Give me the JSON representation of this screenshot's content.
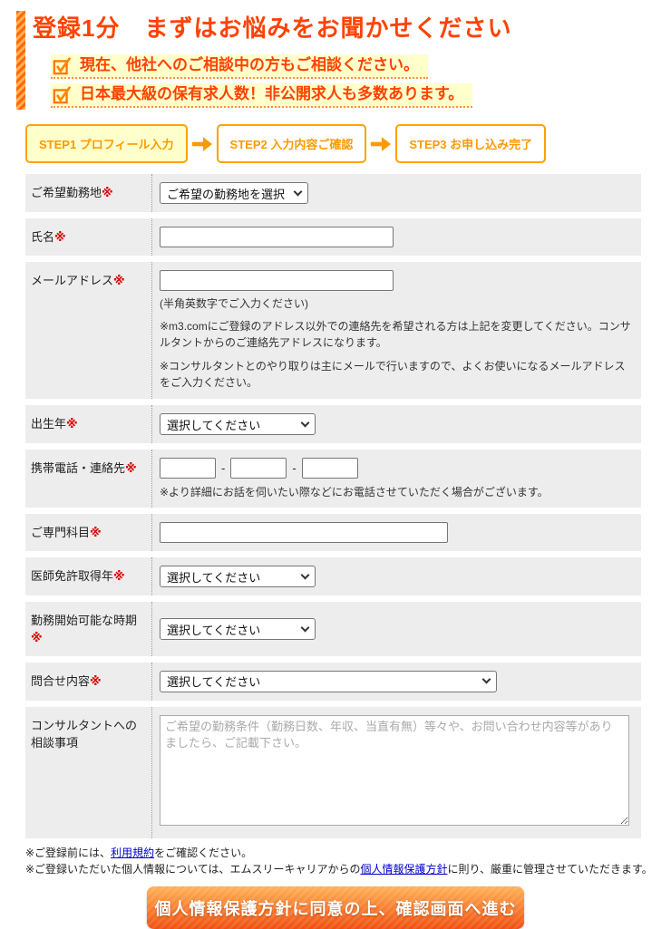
{
  "header": {
    "title": "登録1分　まずはお悩みをお聞かせください",
    "bullets": [
      "現在、他社へのご相談中の方もご相談ください。",
      "日本最大級の保有求人数！非公開求人も多数あります。"
    ]
  },
  "steps": {
    "step1": "STEP1 プロフィール入力",
    "step2": "STEP2 入力内容ご確認",
    "step3": "STEP3 お申し込み完了"
  },
  "form": {
    "required_mark": "※",
    "phone_separator": "-",
    "rows": [
      {
        "label": "ご希望勤務地",
        "select_value": "ご希望の勤務地を選択"
      },
      {
        "label": "氏名"
      },
      {
        "label": "メールアドレス",
        "hint": "(半角英数字でご入力ください)",
        "note1": "※m3.comにご登録のアドレス以外での連絡先を希望される方は上記を変更してください。コンサルタントからのご連絡先アドレスになります。",
        "note2": "※コンサルタントとのやり取りは主にメールで行いますので、よくお使いになるメールアドレスをご入力ください。"
      },
      {
        "label": "出生年",
        "select_value": "選択してください"
      },
      {
        "label": "携帯電話・連絡先",
        "note": "※より詳細にお話を伺いたい際などにお電話させていただく場合がございます。"
      },
      {
        "label": "ご専門科目"
      },
      {
        "label": "医師免許取得年",
        "select_value": "選択してください"
      },
      {
        "label": "勤務開始可能な時期",
        "select_value": "選択してください"
      },
      {
        "label": "問合せ内容",
        "select_value": "選択してください"
      },
      {
        "label": "コンサルタントへの相談事項",
        "placeholder": "ご希望の勤務条件（勤務日数、年収、当直有無）等々や、お問い合わせ内容等がありましたら、ご記載下さい。"
      }
    ]
  },
  "footer": {
    "note1_prefix": "※ご登録前には、",
    "note1_link": "利用規約",
    "note1_suffix": "をご確認ください。",
    "note2_prefix": "※ご登録いただいた個人情報については、エムスリーキャリアからの",
    "note2_link": "個人情報保護方針",
    "note2_suffix": "に則り、厳重に管理させていただきます。",
    "submit_label": "個人情報保護方針に同意の上、確認画面へ進む"
  },
  "colors": {
    "accent_orange": "#ff9900",
    "title_red": "#ff4200",
    "highlight_yellow": "#ffffcc",
    "row_gray": "#ededed",
    "link_blue": "#0000cc",
    "required_red": "#dd0000"
  }
}
